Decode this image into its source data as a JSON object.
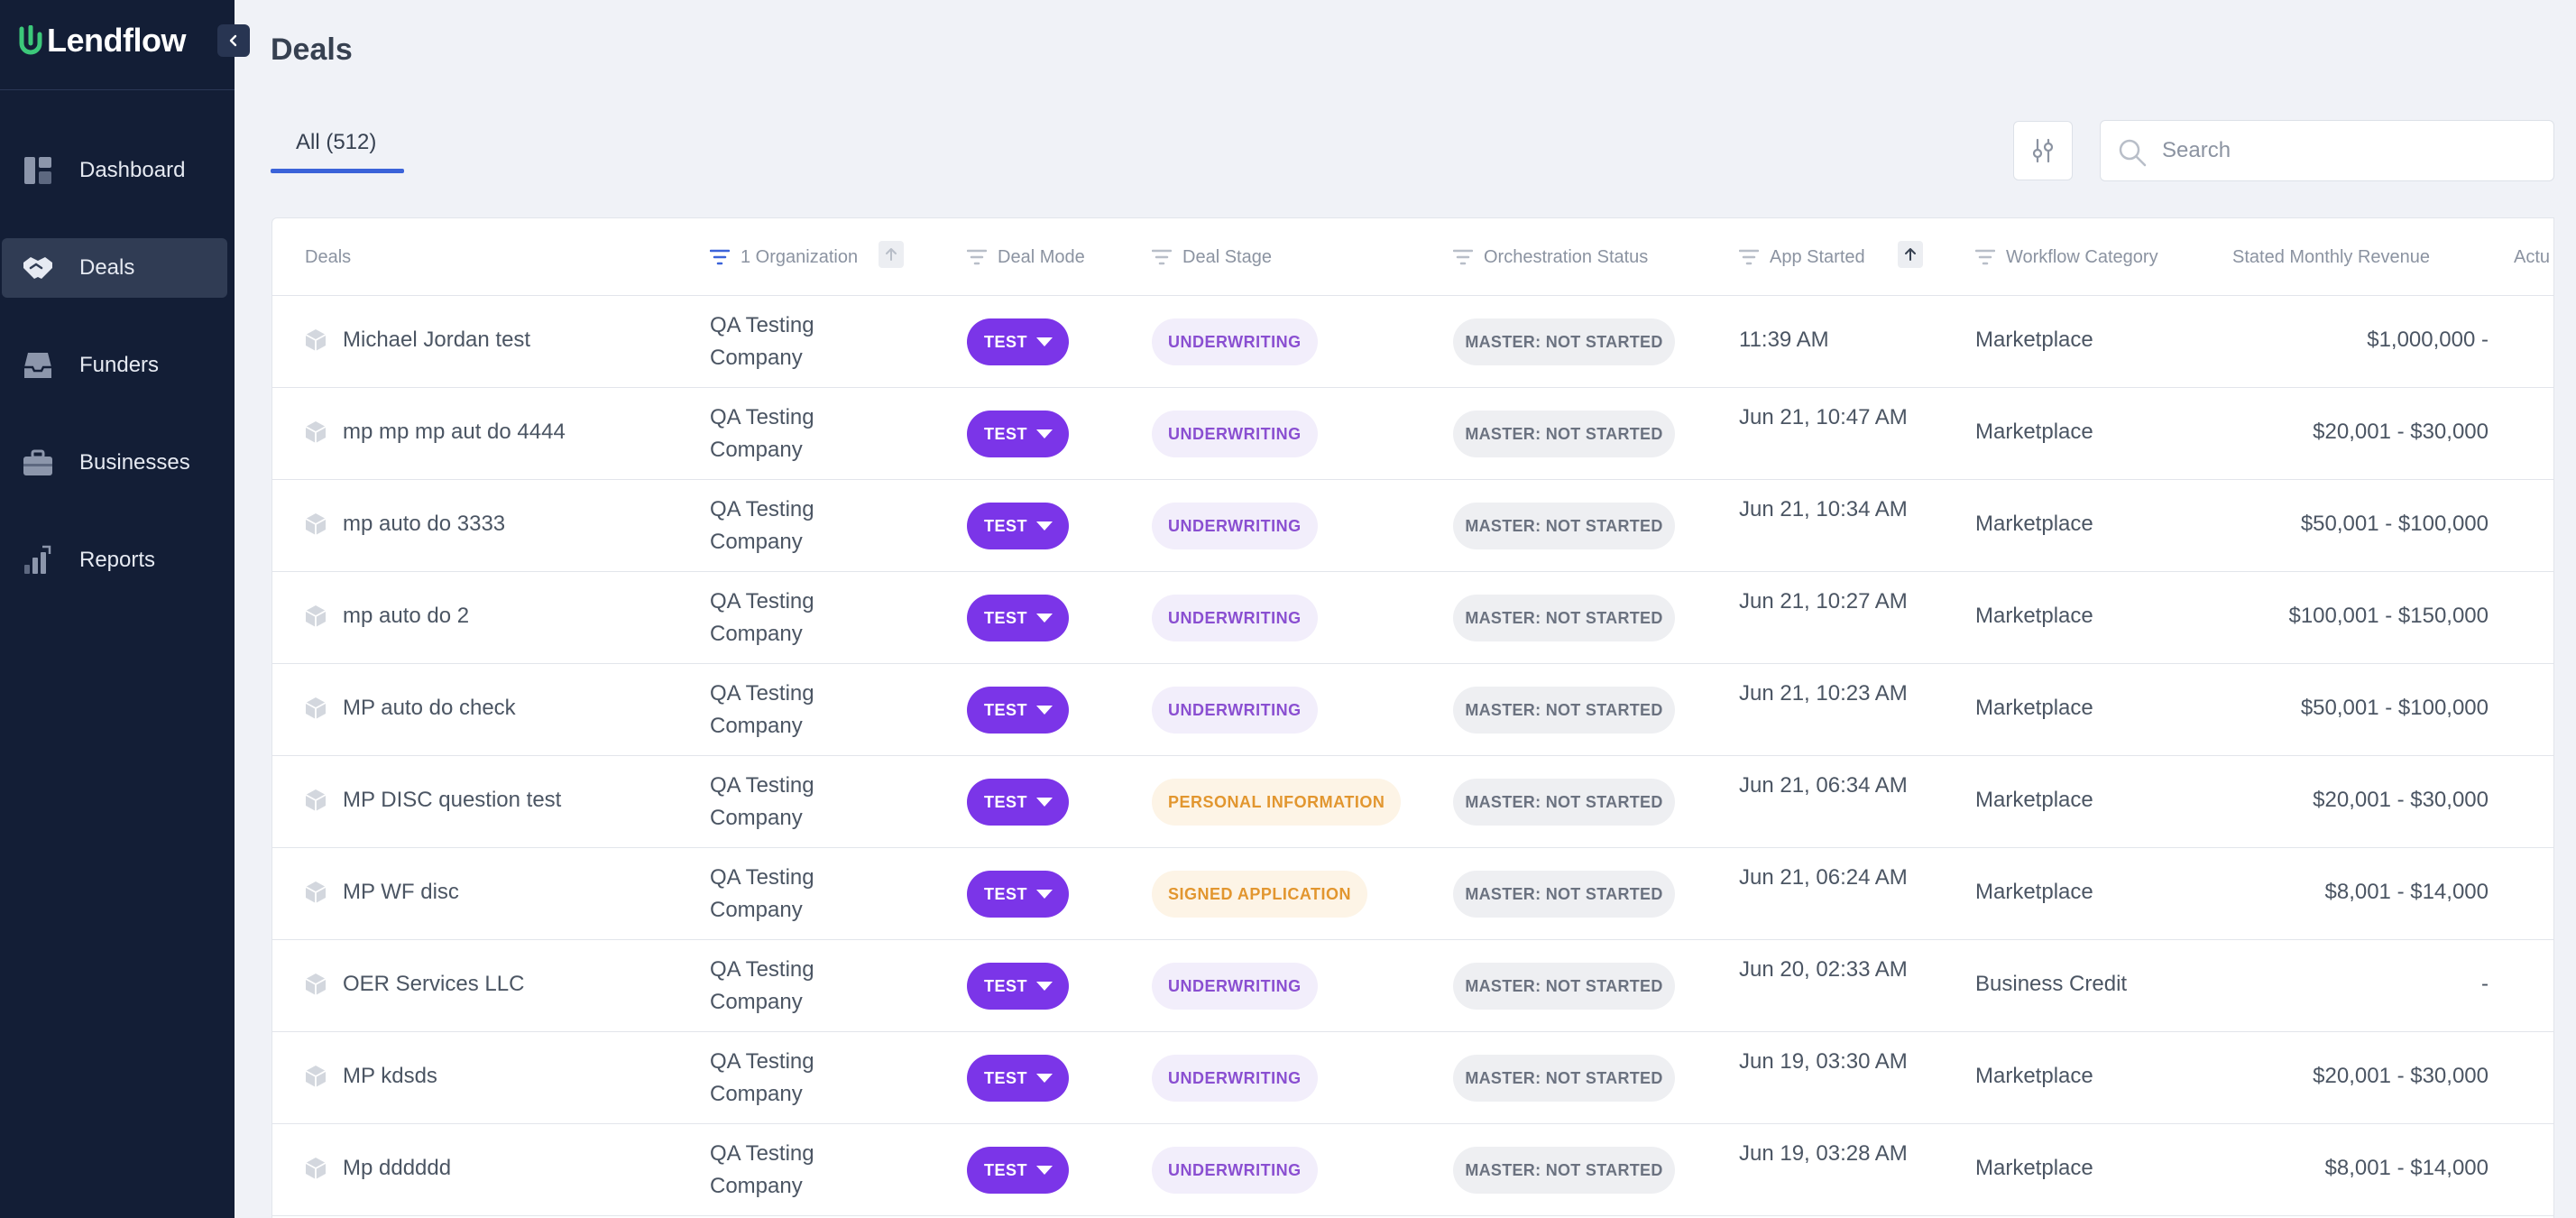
{
  "app": {
    "name": "Lendflow"
  },
  "sidebar": {
    "items": [
      {
        "label": "Dashboard",
        "icon": "dashboard-icon",
        "active": false
      },
      {
        "label": "Deals",
        "icon": "handshake-icon",
        "active": true
      },
      {
        "label": "Funders",
        "icon": "inbox-icon",
        "active": false
      },
      {
        "label": "Businesses",
        "icon": "briefcase-icon",
        "active": false
      },
      {
        "label": "Reports",
        "icon": "bar-chart-icon",
        "active": false
      }
    ]
  },
  "header": {
    "title": "Deals"
  },
  "tabs": [
    {
      "label": "All (512)",
      "active": true
    }
  ],
  "search": {
    "placeholder": "Search",
    "value": ""
  },
  "table": {
    "columns": {
      "deals": "Deals",
      "organization": "1 Organization",
      "deal_mode": "Deal Mode",
      "deal_stage": "Deal Stage",
      "orchestration_status": "Orchestration Status",
      "app_started": "App Started",
      "workflow_category": "Workflow Category",
      "stated_monthly_revenue": "Stated Monthly Revenue",
      "actual": "Actu"
    },
    "rows": [
      {
        "name": "Michael Jordan test",
        "org": "QA Testing Company",
        "mode": "TEST",
        "stage": "UNDERWRITING",
        "stage_color": "purple",
        "orch": "MASTER: NOT STARTED",
        "started": "11:39 AM",
        "workflow": "Marketplace",
        "revenue": "$1,000,000 -"
      },
      {
        "name": "mp mp mp aut do 4444",
        "org": "QA Testing Company",
        "mode": "TEST",
        "stage": "UNDERWRITING",
        "stage_color": "purple",
        "orch": "MASTER: NOT STARTED",
        "started": "Jun 21, 10:47 AM",
        "workflow": "Marketplace",
        "revenue": "$20,001 - $30,000"
      },
      {
        "name": "mp auto do 3333",
        "org": "QA Testing Company",
        "mode": "TEST",
        "stage": "UNDERWRITING",
        "stage_color": "purple",
        "orch": "MASTER: NOT STARTED",
        "started": "Jun 21, 10:34 AM",
        "workflow": "Marketplace",
        "revenue": "$50,001 - $100,000"
      },
      {
        "name": "mp auto do 2",
        "org": "QA Testing Company",
        "mode": "TEST",
        "stage": "UNDERWRITING",
        "stage_color": "purple",
        "orch": "MASTER: NOT STARTED",
        "started": "Jun 21, 10:27 AM",
        "workflow": "Marketplace",
        "revenue": "$100,001 - $150,000"
      },
      {
        "name": "MP auto do check",
        "org": "QA Testing Company",
        "mode": "TEST",
        "stage": "UNDERWRITING",
        "stage_color": "purple",
        "orch": "MASTER: NOT STARTED",
        "started": "Jun 21, 10:23 AM",
        "workflow": "Marketplace",
        "revenue": "$50,001 - $100,000"
      },
      {
        "name": "MP DISC question test",
        "org": "QA Testing Company",
        "mode": "TEST",
        "stage": "PERSONAL INFORMATION",
        "stage_color": "orange",
        "orch": "MASTER: NOT STARTED",
        "started": "Jun 21, 06:34 AM",
        "workflow": "Marketplace",
        "revenue": "$20,001 - $30,000"
      },
      {
        "name": "MP WF disc",
        "org": "QA Testing Company",
        "mode": "TEST",
        "stage": "SIGNED APPLICATION",
        "stage_color": "orange",
        "orch": "MASTER: NOT STARTED",
        "started": "Jun 21, 06:24 AM",
        "workflow": "Marketplace",
        "revenue": "$8,001 - $14,000"
      },
      {
        "name": "OER Services LLC",
        "org": "QA Testing Company",
        "mode": "TEST",
        "stage": "UNDERWRITING",
        "stage_color": "purple",
        "orch": "MASTER: NOT STARTED",
        "started": "Jun 20, 02:33 AM",
        "workflow": "Business Credit",
        "revenue": "-"
      },
      {
        "name": "MP kdsds",
        "org": "QA Testing Company",
        "mode": "TEST",
        "stage": "UNDERWRITING",
        "stage_color": "purple",
        "orch": "MASTER: NOT STARTED",
        "started": "Jun 19, 03:30 AM",
        "workflow": "Marketplace",
        "revenue": "$20,001 - $30,000"
      },
      {
        "name": "Mp dddddd",
        "org": "QA Testing Company",
        "mode": "TEST",
        "stage": "UNDERWRITING",
        "stage_color": "purple",
        "orch": "MASTER: NOT STARTED",
        "started": "Jun 19, 03:28 AM",
        "workflow": "Marketplace",
        "revenue": "$8,001 - $14,000"
      }
    ]
  },
  "colors": {
    "sidebar_bg": "#131e36",
    "accent": "#3b63d9",
    "mode_button": "#7b35e8",
    "stage_purple": "#8a4fd1",
    "stage_orange": "#e2962f",
    "brand_green": "#3cc87a"
  }
}
